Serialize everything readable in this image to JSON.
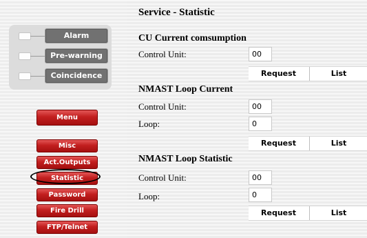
{
  "status_panel": {
    "alarm": "Alarm",
    "prewarning": "Pre-warning",
    "coincidence": "Coincidence"
  },
  "nav": {
    "menu": "Menu",
    "misc": "Misc",
    "act_outputs": "Act.Outputs",
    "statistic": "Statistic",
    "password": "Password",
    "fire_drill": "Fire Drill",
    "ftp_telnet": "FTP/Telnet"
  },
  "main": {
    "title": "Service - Statistic",
    "cu_current": {
      "title": "CU Current comsumption",
      "control_unit_label": "Control Unit:",
      "control_unit_value": "00",
      "request": "Request",
      "list": "List"
    },
    "nmast_current": {
      "title": "NMAST Loop Current",
      "control_unit_label": "Control Unit:",
      "control_unit_value": "00",
      "loop_label": "Loop:",
      "loop_value": "0",
      "request": "Request",
      "list": "List"
    },
    "nmast_statistic": {
      "title": "NMAST Loop Statistic",
      "control_unit_label": "Control Unit:",
      "control_unit_value": "00",
      "loop_label": "Loop:",
      "loop_value": "0",
      "request": "Request",
      "list": "List"
    }
  },
  "colors": {
    "nav_red": "#c21f1f",
    "status_gray": "#717171",
    "highlight": "#000000"
  }
}
